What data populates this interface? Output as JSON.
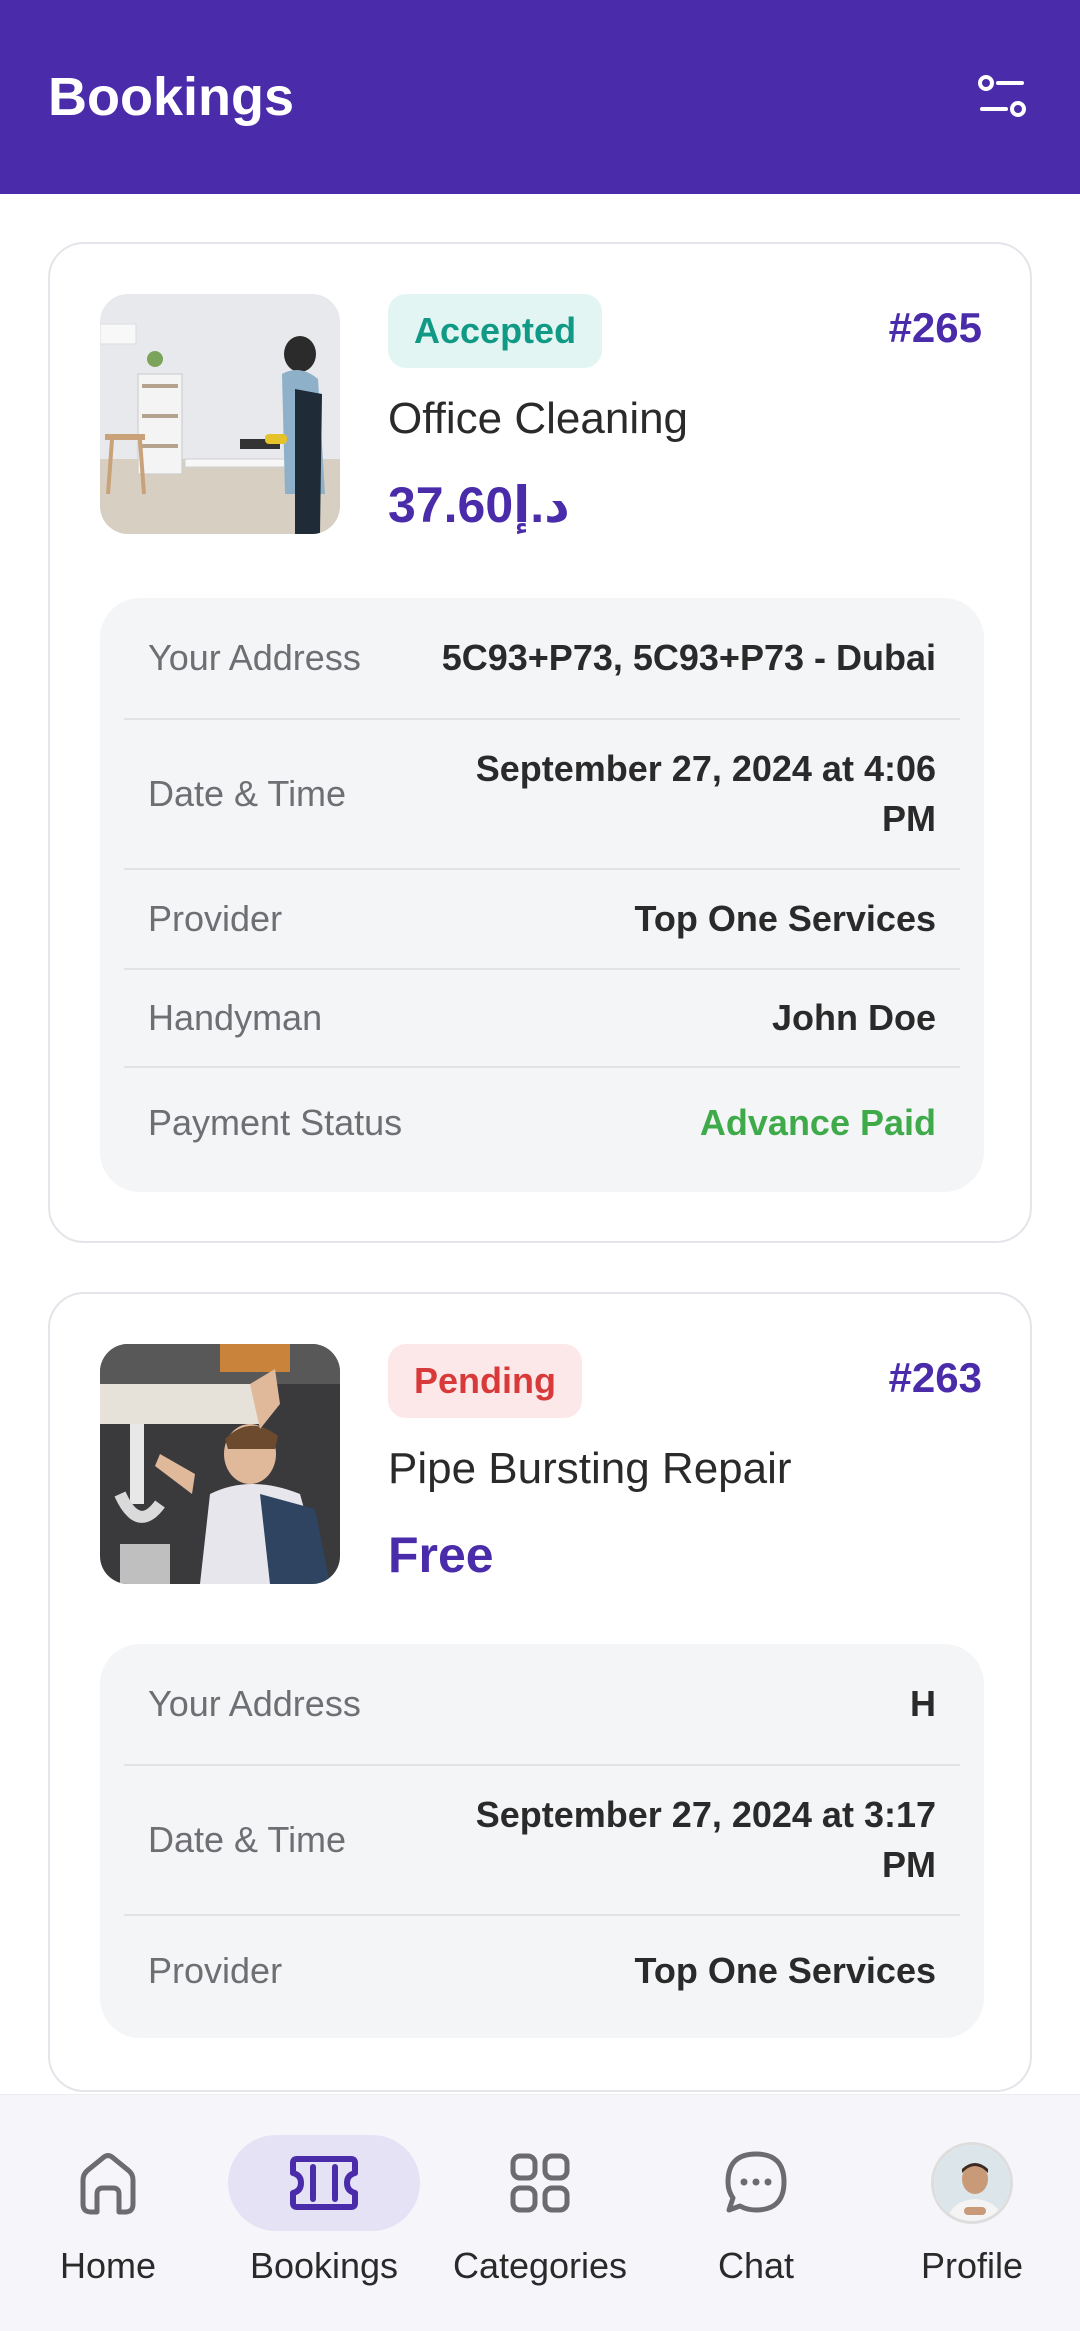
{
  "header": {
    "title": "Bookings",
    "filter_icon": "filter-icon"
  },
  "bookings": [
    {
      "status": "Accepted",
      "id": "#265",
      "service": "Office Cleaning",
      "price": "37.60د.إ",
      "details": {
        "address_label": "Your Address",
        "address_value": "5C93+P73, 5C93+P73 - Dubai",
        "datetime_label": "Date & Time",
        "datetime_value_1": "September 27, 2024 at 4:06",
        "datetime_value_2": "PM",
        "provider_label": "Provider",
        "provider_value": "Top One Services",
        "handyman_label": "Handyman",
        "handyman_value": "John Doe",
        "payment_label": "Payment Status",
        "payment_value": "Advance Paid"
      }
    },
    {
      "status": "Pending",
      "id": "#263",
      "service": "Pipe Bursting Repair",
      "price": "Free",
      "details": {
        "address_label": "Your Address",
        "address_value": "H",
        "datetime_label": "Date & Time",
        "datetime_value_1": "September 27, 2024 at 3:17",
        "datetime_value_2": "PM",
        "provider_label": "Provider",
        "provider_value": "Top One Services"
      }
    }
  ],
  "nav": {
    "home": "Home",
    "bookings": "Bookings",
    "categories": "Categories",
    "chat": "Chat",
    "profile": "Profile"
  },
  "colors": {
    "primary": "#4A2BAA",
    "accepted": "#109A86",
    "pending": "#D83A3A",
    "paid": "#3EAA4A"
  }
}
